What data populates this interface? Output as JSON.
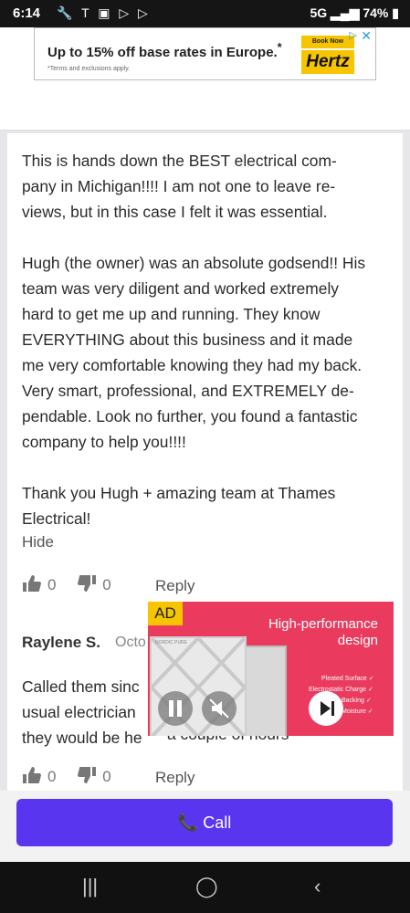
{
  "status": {
    "time": "6:14",
    "network": "5G",
    "battery": "74%"
  },
  "top_ad": {
    "headline": "Up to 15% off base rates in Europe.",
    "headline_mark": "*",
    "fine_print": "*Terms and exclusions apply.",
    "cta": "Book Now",
    "brand": "Hertz"
  },
  "review1": {
    "text": "This is hands down the BEST electrical com-\npany in Michigan!!!! I am not one to leave re-\nviews, but in this case I felt it was essential.\n\nHugh (the owner) was an absolute godsend!! His\nteam was very diligent and worked extremely\nhard to get me up and running. They know\nEVERYTHING about this business and it made\nme very comfortable knowing they had my back.\nVery smart, professional, and EXTREMELY de-\npendable. Look no further, you found a fantastic\ncompany to help you!!!!\n\nThank you Hugh + amazing team at Thames\nElectrical!",
    "hide_label": "Hide",
    "likes": "0",
    "dislikes": "0",
    "reply_label": "Reply"
  },
  "review2": {
    "name": "Raylene S.",
    "date": "Octo",
    "text": "Called them sinc\nusual electrician\nthey would be he",
    "text_tail": "a couple of hours",
    "likes": "0",
    "dislikes": "0",
    "reply_label": "Reply"
  },
  "video_ad": {
    "tag": "AD",
    "headline": "High-performance design",
    "features": [
      "Pleated Surface ✓",
      "Electrostatic Charge ✓",
      "Backing ✓",
      "Moisture ✓"
    ],
    "filter_brand": "NORDIC PURE"
  },
  "call": {
    "label": "Call"
  },
  "colors": {
    "call_button": "#5a35f0",
    "ad_bg": "#ea3b5e",
    "ad_tag": "#f6c500",
    "hertz_yellow": "#f6c500"
  }
}
